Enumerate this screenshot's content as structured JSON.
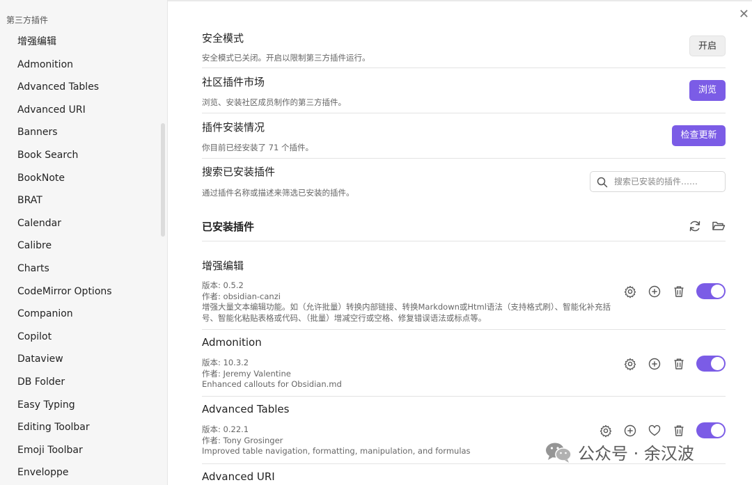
{
  "sidebar": {
    "header": "第三方插件",
    "items": [
      "增强编辑",
      "Admonition",
      "Advanced Tables",
      "Advanced URI",
      "Banners",
      "Book Search",
      "BookNote",
      "BRAT",
      "Calendar",
      "Calibre",
      "Charts",
      "CodeMirror Options",
      "Companion",
      "Copilot",
      "Dataview",
      "DB Folder",
      "Easy Typing",
      "Editing Toolbar",
      "Emoji Toolbar",
      "Enveloppe"
    ]
  },
  "settings": {
    "safe_mode": {
      "title": "安全模式",
      "desc": "安全模式已关闭。开启以限制第三方插件运行。",
      "button": "开启"
    },
    "community": {
      "title": "社区插件市场",
      "desc": "浏览、安装社区成员制作的第三方插件。",
      "button": "浏览"
    },
    "install_status": {
      "title": "插件安装情况",
      "desc": "你目前已经安装了 71 个插件。",
      "button": "检查更新"
    },
    "search": {
      "title": "搜索已安装插件",
      "desc": "通过插件名称或描述来筛选已安装的插件。",
      "placeholder": "搜索已安装的插件……"
    }
  },
  "installed": {
    "title": "已安装插件",
    "plugins": [
      {
        "name": "增强编辑",
        "version": "版本: 0.5.2",
        "author": "作者: obsidian-canzi",
        "desc": "增强大量文本编辑功能。如（允许批量）转换内部链接、转换Markdown或Html语法（支持格式刷）、智能化补充括号、智能化粘贴表格或代码、（批量）增减空行或空格、修复错误语法或标点等。",
        "enabled": true
      },
      {
        "name": "Admonition",
        "version": "版本: 10.3.2",
        "author": "作者: Jeremy Valentine",
        "desc": "Enhanced callouts for Obsidian.md",
        "enabled": true
      },
      {
        "name": "Advanced Tables",
        "version": "版本: 0.22.1",
        "author": "作者: Tony Grosinger",
        "desc": "Improved table navigation, formatting, manipulation, and formulas",
        "enabled": true
      },
      {
        "name": "Advanced URI"
      }
    ]
  },
  "watermark": {
    "text": "公众号 · 余汉波"
  },
  "colors": {
    "accent": "#7b5ce6",
    "sidebar_bg": "#f6f6f6"
  }
}
